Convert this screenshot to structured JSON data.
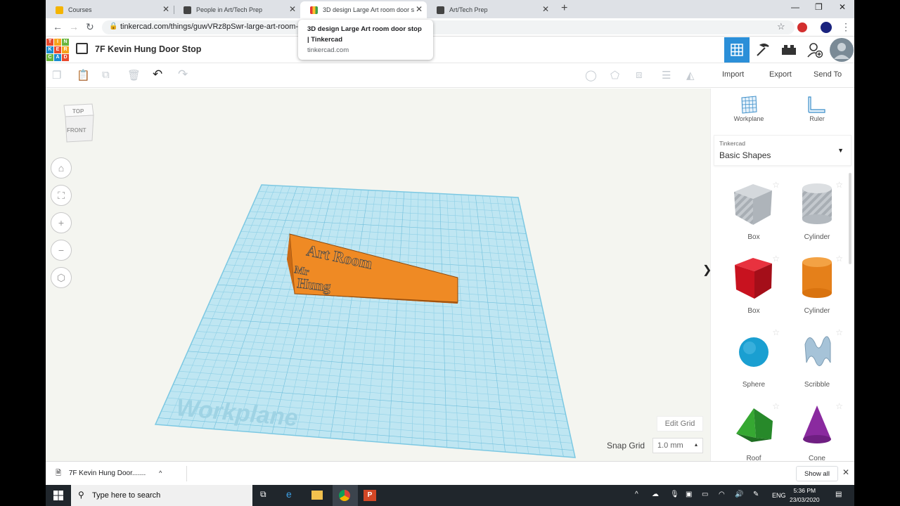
{
  "browser": {
    "tabs": [
      {
        "label": "Courses",
        "color": "#f4b400"
      },
      {
        "label": "People in Art/Tech Prep",
        "color": "#444444"
      },
      {
        "label": "3D design Large Art room door stop | Tinkercad",
        "color": "#4caf50"
      },
      {
        "label": "Art/Tech Prep",
        "color": "#444444"
      }
    ],
    "url": "tinkercad.com/things/guwVRz8pSwr-large-art-room-door-stop/edit",
    "tooltip": {
      "title": "3D design Large Art room door stop | Tinkercad",
      "domain": "tinkercad.com"
    }
  },
  "app": {
    "logo_letters": [
      "T",
      "I",
      "N",
      "K",
      "E",
      "R",
      "C",
      "A",
      "D"
    ],
    "design_title": "7F Kevin Hung Door Stop",
    "toolbar": {
      "import_label": "Import",
      "export_label": "Export",
      "send_to_label": "Send To"
    },
    "workspace": {
      "viewcube_top": "TOP",
      "viewcube_front": "FRONT",
      "workplane_label": "Workplane",
      "model_text_main": "Art Room",
      "model_text_mr": "Mr",
      "model_text_name": "Hung",
      "edit_grid_label": "Edit Grid",
      "snap_grid_label": "Snap Grid",
      "snap_grid_value": "1.0 mm"
    },
    "panel": {
      "workplane_label": "Workplane",
      "ruler_label": "Ruler",
      "library_small": "Tinkercad",
      "library_name": "Basic Shapes",
      "shapes": [
        {
          "label": "Box",
          "color": "#b9bec4"
        },
        {
          "label": "Cylinder",
          "color": "#b9bec4"
        },
        {
          "label": "Box",
          "color": "#d6162a"
        },
        {
          "label": "Cylinder",
          "color": "#e5801a"
        },
        {
          "label": "Sphere",
          "color": "#1a9fd1"
        },
        {
          "label": "Scribble",
          "color": "#a6c3d8"
        },
        {
          "label": "Roof",
          "color": "#36a832"
        },
        {
          "label": "Cone",
          "color": "#8a2a9f"
        }
      ]
    }
  },
  "downloads": {
    "item": "7F Kevin Hung Door.......",
    "show_all": "Show all"
  },
  "taskbar": {
    "search_placeholder": "Type here to search",
    "lang": "ENG",
    "time": "5:36 PM",
    "date": "23/03/2020"
  }
}
